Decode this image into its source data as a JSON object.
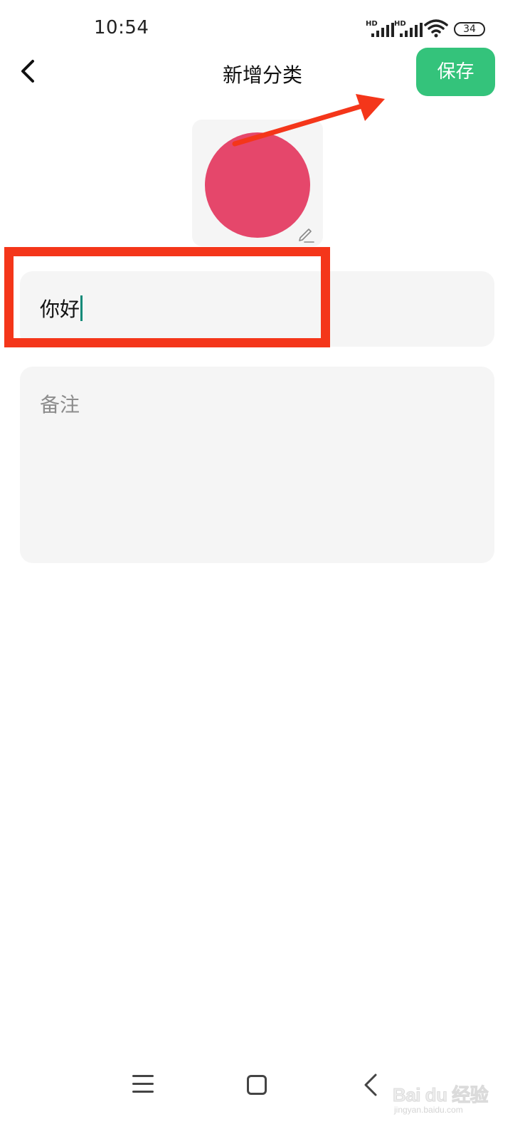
{
  "status_bar": {
    "time": "10:54",
    "signal_1_label": "HD",
    "signal_2_label": "HD",
    "battery": "34"
  },
  "header": {
    "title": "新增分类",
    "save_label": "保存",
    "back_icon": "chevron-left-icon"
  },
  "category_icon": {
    "color": "#e5476b",
    "edit_icon": "pencil-icon"
  },
  "form": {
    "name_value": "你好",
    "note_placeholder": "备注"
  },
  "annotations": {
    "highlight_color": "#f4361a"
  },
  "nav": {
    "menu_icon": "menu-icon",
    "home_icon": "square-home-icon",
    "back_icon": "back-triangle-icon"
  },
  "watermark": {
    "brand": "Bai du 经验",
    "sub": "jingyan.baidu.com"
  },
  "colors": {
    "accent": "#34c37b",
    "field_bg": "#f5f5f5",
    "caret": "#118a78"
  }
}
